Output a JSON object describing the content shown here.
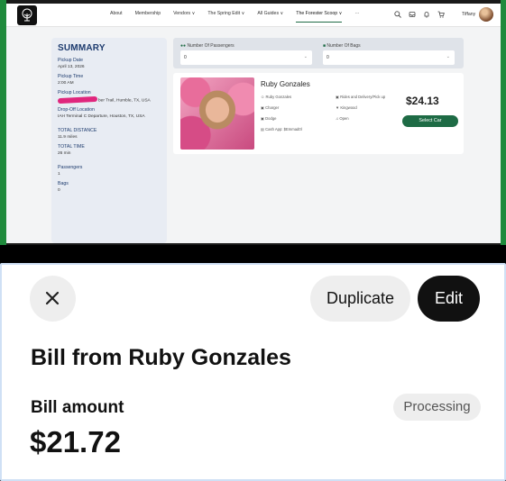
{
  "navbar": {
    "links": [
      "About",
      "Membership",
      "Vendors ∨",
      "The Spring Edit ∨",
      "All Guides ∨",
      "The Forester Scoop ∨",
      "···"
    ],
    "user": "Tiffany"
  },
  "summary": {
    "title": "SUMMARY",
    "pickup_date_label": "Pickup Date",
    "pickup_date": "April 13, 2026",
    "pickup_time_label": "Pickup Time",
    "pickup_time": "2:00 AM",
    "pickup_location_label": "Pickup Location",
    "pickup_location": "ber Trail, Humble, TX, USA",
    "dropoff_label": "Drop-Off Location",
    "dropoff": "IAH Terminal C Departure, Houston, TX, USA",
    "distance_label": "TOTAL DISTANCE",
    "distance": "11.9 miles",
    "time_label": "TOTAL TIME",
    "time": "26 min",
    "passengers_label": "Passengers",
    "passengers": "1",
    "bags_label": "Bags",
    "bags": "0"
  },
  "filters": {
    "passengers_label": "Number Of Passengers",
    "passengers_value": "0",
    "bags_label": "Number Of Bags",
    "bags_value": "0"
  },
  "driver_card": {
    "name": "Ruby Gonzales",
    "attr_driver": "Ruby Gonzales",
    "attr_charger": "Charger",
    "attr_make": "Dodge",
    "attr_payment": "Cash App: $Emmad0l",
    "attr_rides": "Rides and Delivery/Pick up",
    "attr_area": "Kingwood",
    "attr_music": "Open",
    "price": "$24.13",
    "select_label": "Select Car"
  },
  "bill": {
    "duplicate_label": "Duplicate",
    "edit_label": "Edit",
    "title": "Bill from Ruby Gonzales",
    "amount_label": "Bill amount",
    "status": "Processing",
    "amount": "$21.72"
  },
  "colors": {
    "brand_green": "#1e6b45",
    "summary_title": "#1d3b6e",
    "frame_green": "#1f8a3c"
  }
}
